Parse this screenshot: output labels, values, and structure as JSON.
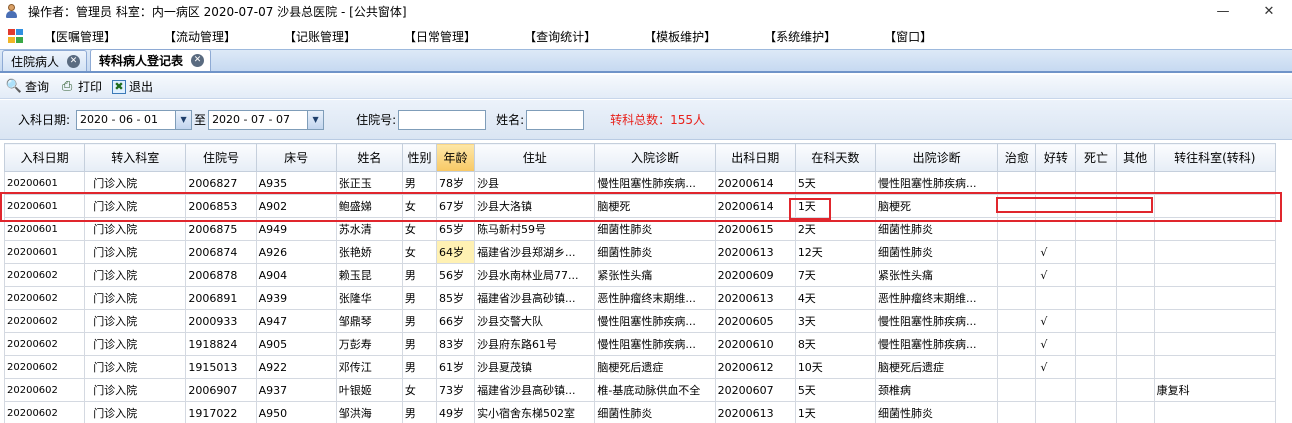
{
  "window": {
    "title": "操作者：管理员  科室：内一病区  2020-07-07  沙县总医院 - [公共窗体]",
    "controls": [
      "—",
      "✕"
    ]
  },
  "menu": {
    "items": [
      "【医嘱管理】",
      "【流动管理】",
      "【记账管理】",
      "【日常管理】",
      "【查询统计】",
      "【模板维护】",
      "【系统维护】",
      "【窗口】"
    ]
  },
  "tabs": [
    {
      "label": "住院病人",
      "active": false
    },
    {
      "label": "转科病人登记表",
      "active": true
    }
  ],
  "toolbar": {
    "query": "查询",
    "print": "打印",
    "exit": "退出"
  },
  "filter": {
    "date_label": "入科日期:",
    "start_date": "2020 - 06 - 01",
    "to_label": "至",
    "end_date": "2020 - 07 - 07",
    "admission_label": "住院号:",
    "admission_value": "",
    "name_label": "姓名:",
    "name_value": "",
    "total": "转科总数：155人"
  },
  "table": {
    "columns": [
      "入科日期",
      "转入科室",
      "住院号",
      "床号",
      "姓名",
      "性别",
      "年龄",
      "住址",
      "入院诊断",
      "出科日期",
      "在科天数",
      "出院诊断",
      "治愈",
      "好转",
      "死亡",
      "其他",
      "转往科室(转科)"
    ],
    "sorted_column": 6,
    "rows": [
      [
        "20200601",
        "门诊入院",
        "2006827",
        "A935",
        "张正玉",
        "男",
        "78岁",
        "沙县",
        "慢性阻塞性肺疾病...",
        "20200614",
        "5天",
        "慢性阻塞性肺疾病...",
        "",
        "",
        "",
        "",
        ""
      ],
      [
        "20200601",
        "门诊入院",
        "2006853",
        "A902",
        "鲍盛娣",
        "女",
        "67岁",
        "沙县大洛镇",
        "脑梗死",
        "20200614",
        "1天",
        "脑梗死",
        "",
        "",
        "",
        "",
        ""
      ],
      [
        "20200601",
        "门诊入院",
        "2006875",
        "A949",
        "苏水清",
        "女",
        "65岁",
        "陈马新村59号",
        "细菌性肺炎",
        "20200615",
        "2天",
        "细菌性肺炎",
        "",
        "",
        "",
        "",
        ""
      ],
      [
        "20200601",
        "门诊入院",
        "2006874",
        "A926",
        "张艳娇",
        "女",
        "64岁",
        "福建省沙县郑湖乡...",
        "细菌性肺炎",
        "20200613",
        "12天",
        "细菌性肺炎",
        "",
        "√",
        "",
        "",
        ""
      ],
      [
        "20200602",
        "门诊入院",
        "2006878",
        "A904",
        "赖玉昆",
        "男",
        "56岁",
        "沙县水南林业局77...",
        "紧张性头痛",
        "20200609",
        "7天",
        "紧张性头痛",
        "",
        "√",
        "",
        "",
        ""
      ],
      [
        "20200602",
        "门诊入院",
        "2006891",
        "A939",
        "张隆华",
        "男",
        "85岁",
        "福建省沙县高砂镇...",
        "恶性肿瘤终末期维...",
        "20200613",
        "4天",
        "恶性肿瘤终末期维...",
        "",
        "",
        "",
        "",
        ""
      ],
      [
        "20200602",
        "门诊入院",
        "2000933",
        "A947",
        "邹鼎琴",
        "男",
        "66岁",
        "沙县交警大队",
        "慢性阻塞性肺疾病...",
        "20200605",
        "3天",
        "慢性阻塞性肺疾病...",
        "",
        "√",
        "",
        "",
        ""
      ],
      [
        "20200602",
        "门诊入院",
        "1918824",
        "A905",
        "万彭寿",
        "男",
        "83岁",
        "沙县府东路61号",
        "慢性阻塞性肺疾病...",
        "20200610",
        "8天",
        "慢性阻塞性肺疾病...",
        "",
        "√",
        "",
        "",
        ""
      ],
      [
        "20200602",
        "门诊入院",
        "1915013",
        "A922",
        "邓传江",
        "男",
        "61岁",
        "沙县夏茂镇",
        "脑梗死后遗症",
        "20200612",
        "10天",
        "脑梗死后遗症",
        "",
        "√",
        "",
        "",
        ""
      ],
      [
        "20200602",
        "门诊入院",
        "2006907",
        "A937",
        "叶银姬",
        "女",
        "73岁",
        "福建省沙县高砂镇...",
        "椎-基底动脉供血不全",
        "20200607",
        "5天",
        "颈椎病",
        "",
        "",
        "",
        "",
        "康复科"
      ],
      [
        "20200602",
        "门诊入院",
        "1917022",
        "A950",
        "邹洪海",
        "男",
        "49岁",
        "实小宿舍东梯502室",
        "细菌性肺炎",
        "20200613",
        "1天",
        "细菌性肺炎",
        "",
        "",
        "",
        "",
        ""
      ]
    ]
  },
  "colors": {
    "highlight_box": "#e0262d",
    "total_text": "#e8211b",
    "sorted_header": "#f8c865",
    "highlight_cell": "#fff1b3"
  }
}
